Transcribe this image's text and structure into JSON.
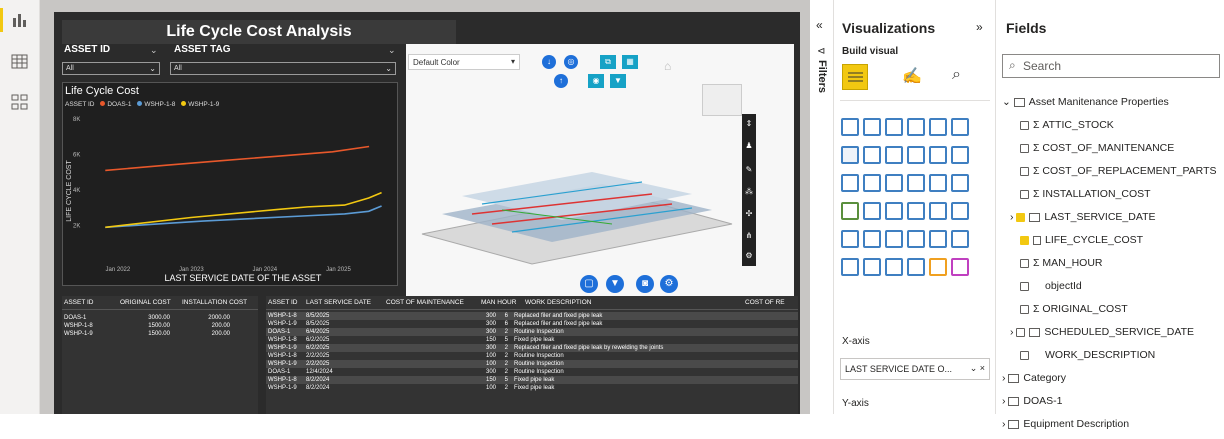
{
  "report": {
    "title": "Life Cycle Cost Analysis",
    "slicers": [
      {
        "label": "ASSET ID",
        "value": "All"
      },
      {
        "label": "ASSET TAG",
        "value": "All"
      }
    ],
    "viewer": {
      "color_dropdown": "Default Color"
    },
    "table1": {
      "headers": [
        "ASSET ID",
        "ORIGINAL COST",
        "INSTALLATION COST"
      ],
      "rows": [
        [
          "DOAS-1",
          "3000.00",
          "2000.00"
        ],
        [
          "WSHP-1-8",
          "1500.00",
          "200.00"
        ],
        [
          "WSHP-1-9",
          "1500.00",
          "200.00"
        ]
      ]
    },
    "table2": {
      "headers": [
        "ASSET ID",
        "LAST SERVICE DATE",
        "COST OF MAINTENANCE",
        "MAN HOUR",
        "WORK DESCRIPTION",
        "COST OF RE"
      ],
      "rows": [
        [
          "WSHP-1-8",
          "8/5/2025",
          "300",
          "6",
          "Replaced filer and fixed pipe leak"
        ],
        [
          "WSHP-1-9",
          "8/5/2025",
          "300",
          "6",
          "Replaced filer and fixed pipe leak"
        ],
        [
          "DOAS-1",
          "6/4/2025",
          "300",
          "2",
          "Routine Inspection"
        ],
        [
          "WSHP-1-8",
          "6/2/2025",
          "150",
          "5",
          "Fixed pipe leak"
        ],
        [
          "WSHP-1-9",
          "6/2/2025",
          "300",
          "2",
          "Replaced filer and fixed pipe leak by rewelding the joints"
        ],
        [
          "WSHP-1-8",
          "2/2/2025",
          "100",
          "2",
          "Routine Inspection"
        ],
        [
          "WSHP-1-9",
          "2/2/2025",
          "100",
          "2",
          "Routine Inspection"
        ],
        [
          "DOAS-1",
          "12/4/2024",
          "300",
          "2",
          "Routine Inspection"
        ],
        [
          "WSHP-1-8",
          "8/2/2024",
          "150",
          "5",
          "Fixed pipe leak"
        ],
        [
          "WSHP-1-9",
          "8/2/2024",
          "100",
          "2",
          "Fixed pipe leak"
        ]
      ]
    }
  },
  "chart_data": {
    "type": "line",
    "title": "Life Cycle Cost",
    "xlabel": "LAST SERVICE DATE OF THE ASSET",
    "ylabel": "LIFE CYCLE COST",
    "legend_title": "ASSET ID",
    "ylim": [
      0,
      8000
    ],
    "yticks": [
      "2K",
      "4K",
      "6K",
      "8K"
    ],
    "xticks": [
      "Jan 2022",
      "Jan 2023",
      "Jan 2024",
      "Jan 2025"
    ],
    "xlim": [
      "2021-09-01",
      "2025-09-01"
    ],
    "series": [
      {
        "name": "DOAS-1",
        "color": "#e8582b",
        "points": [
          [
            "2021-11-01",
            5100
          ],
          [
            "2022-09-01",
            5400
          ],
          [
            "2023-06-01",
            5650
          ],
          [
            "2024-03-01",
            5900
          ],
          [
            "2024-12-04",
            6150
          ],
          [
            "2025-06-04",
            6450
          ]
        ]
      },
      {
        "name": "WSHP-1-8",
        "color": "#5b9bd5",
        "points": [
          [
            "2021-11-01",
            1900
          ],
          [
            "2023-03-01",
            2250
          ],
          [
            "2024-08-02",
            2550
          ],
          [
            "2025-02-02",
            2650
          ],
          [
            "2025-06-02",
            2800
          ],
          [
            "2025-08-05",
            3100
          ]
        ]
      },
      {
        "name": "WSHP-1-9",
        "color": "#f2c811",
        "points": [
          [
            "2021-11-01",
            1900
          ],
          [
            "2023-01-01",
            2450
          ],
          [
            "2024-03-01",
            2900
          ],
          [
            "2024-08-02",
            3050
          ],
          [
            "2025-02-02",
            3150
          ],
          [
            "2025-06-02",
            3550
          ],
          [
            "2025-08-05",
            3850
          ]
        ]
      }
    ]
  },
  "visualizations": {
    "title": "Visualizations",
    "build_visual": "Build visual",
    "xaxis_label": "X-axis",
    "xaxis_field": "LAST SERVICE DATE O...",
    "yaxis_label": "Y-axis"
  },
  "filters_label": "Filters",
  "fields": {
    "title": "Fields",
    "search_placeholder": "Search",
    "items": [
      {
        "label": "Asset Manitenance Properties",
        "kind": "table-expanded"
      },
      {
        "label": "ATTIC_STOCK",
        "kind": "sigma"
      },
      {
        "label": "COST_OF_MANITENANCE",
        "kind": "sigma"
      },
      {
        "label": "COST_OF_REPLACEMENT_PARTS",
        "kind": "sigma"
      },
      {
        "label": "INSTALLATION_COST",
        "kind": "sigma"
      },
      {
        "label": "LAST_SERVICE_DATE",
        "kind": "date-checked"
      },
      {
        "label": "LIFE_CYCLE_COST",
        "kind": "field-checked"
      },
      {
        "label": "MAN_HOUR",
        "kind": "sigma"
      },
      {
        "label": "objectId",
        "kind": "plain"
      },
      {
        "label": "ORIGINAL_COST",
        "kind": "sigma"
      },
      {
        "label": "SCHEDULED_SERVICE_DATE",
        "kind": "date"
      },
      {
        "label": "WORK_DESCRIPTION",
        "kind": "plain"
      },
      {
        "label": "Category",
        "kind": "table"
      },
      {
        "label": "DOAS-1",
        "kind": "table"
      },
      {
        "label": "Equipment Description",
        "kind": "table"
      }
    ]
  }
}
